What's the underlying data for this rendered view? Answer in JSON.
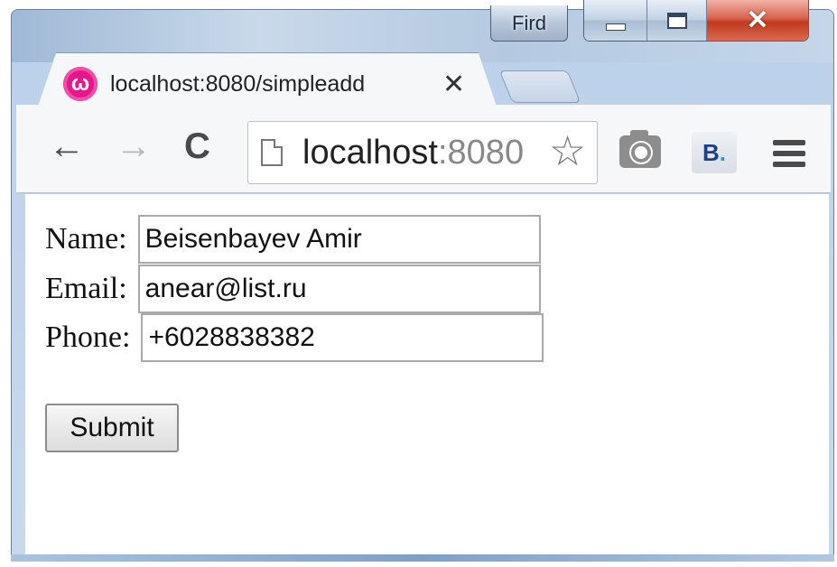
{
  "window": {
    "profile_name": "Fird",
    "close_glyph": "✕"
  },
  "tab": {
    "favicon_letter": "ω",
    "title": "localhost:8080/simpleadd",
    "close_glyph": "✕"
  },
  "toolbar": {
    "back_glyph": "←",
    "forward_glyph": "→",
    "reload_glyph": "C",
    "url_host": "localhost",
    "url_port": ":8080",
    "star_glyph": "☆",
    "extension_label": "B",
    "extension_dot": "."
  },
  "form": {
    "name_label": "Name:",
    "name_value": "Beisenbayev Amir",
    "email_label": "Email:",
    "email_value": "anear@list.ru",
    "phone_label": "Phone:",
    "phone_value": "+6028838382",
    "submit_label": "Submit"
  },
  "colors": {
    "favicon": "#e8168c",
    "close_button": "#c0391f",
    "extension": "#1b3f8f"
  }
}
